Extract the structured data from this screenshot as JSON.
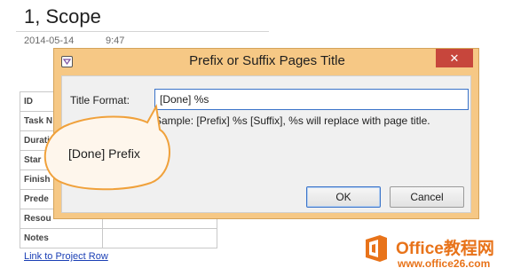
{
  "page": {
    "title": "1, Scope",
    "date": "2014-05-14",
    "time": "9:47",
    "table_rows": [
      "ID",
      "Task N",
      "Durati",
      "Star",
      "Finish",
      "Prede",
      "Resou",
      "Notes"
    ],
    "link": "Link to Project Row"
  },
  "dialog": {
    "title": "Prefix or Suffix Pages Title",
    "close_glyph": "✕",
    "format_label": "Title Format:",
    "format_value": "[Done] %s",
    "sample_text": "Sample: [Prefix] %s [Suffix], %s will replace with page title.",
    "ok_label": "OK",
    "cancel_label": "Cancel"
  },
  "callout": {
    "text": "[Done] Prefix"
  },
  "watermark": {
    "line1": "Office教程网",
    "line2": "www.office26.com"
  },
  "colors": {
    "callout_fill": "#fef6ec",
    "callout_stroke": "#f0a13b",
    "dialog_frame": "#f6c885",
    "close": "#c7463c",
    "watermark": "#e8731a"
  },
  "icons": [
    "app-icon",
    "close-icon",
    "office-logo-icon"
  ]
}
